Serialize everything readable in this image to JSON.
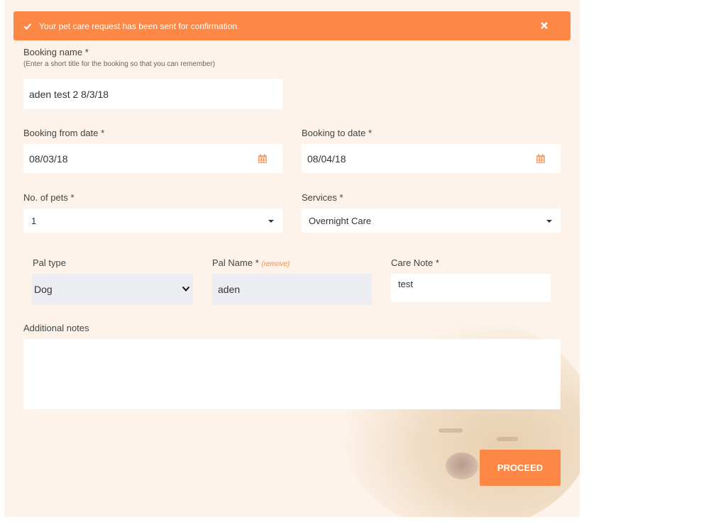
{
  "alert": {
    "message": "Your pet care request has been sent for confirmation.",
    "icon": "check-icon",
    "close_icon": "close-icon",
    "color": "#fd8845"
  },
  "booking_name": {
    "label": "Booking name *",
    "hint": "(Enter a short title for the booking so that you can remember)",
    "value": "aden test 2 8/3/18"
  },
  "from_date": {
    "label": "Booking from date *",
    "value": "08/03/18",
    "icon": "calendar-icon"
  },
  "to_date": {
    "label": "Booking to date *",
    "value": "08/04/18",
    "icon": "calendar-icon"
  },
  "pets": {
    "label": "No. of pets *",
    "value": "1"
  },
  "services": {
    "label": "Services *",
    "value": "Overnight Care"
  },
  "pal_type": {
    "label": "Pal type",
    "value": "Dog"
  },
  "pal_name": {
    "label": "Pal Name *",
    "remove": "(remove)",
    "value": "aden"
  },
  "care_note": {
    "label": "Care Note *",
    "value": "test"
  },
  "additional_notes": {
    "label": "Additional notes",
    "value": ""
  },
  "proceed": {
    "label": "PROCEED"
  }
}
